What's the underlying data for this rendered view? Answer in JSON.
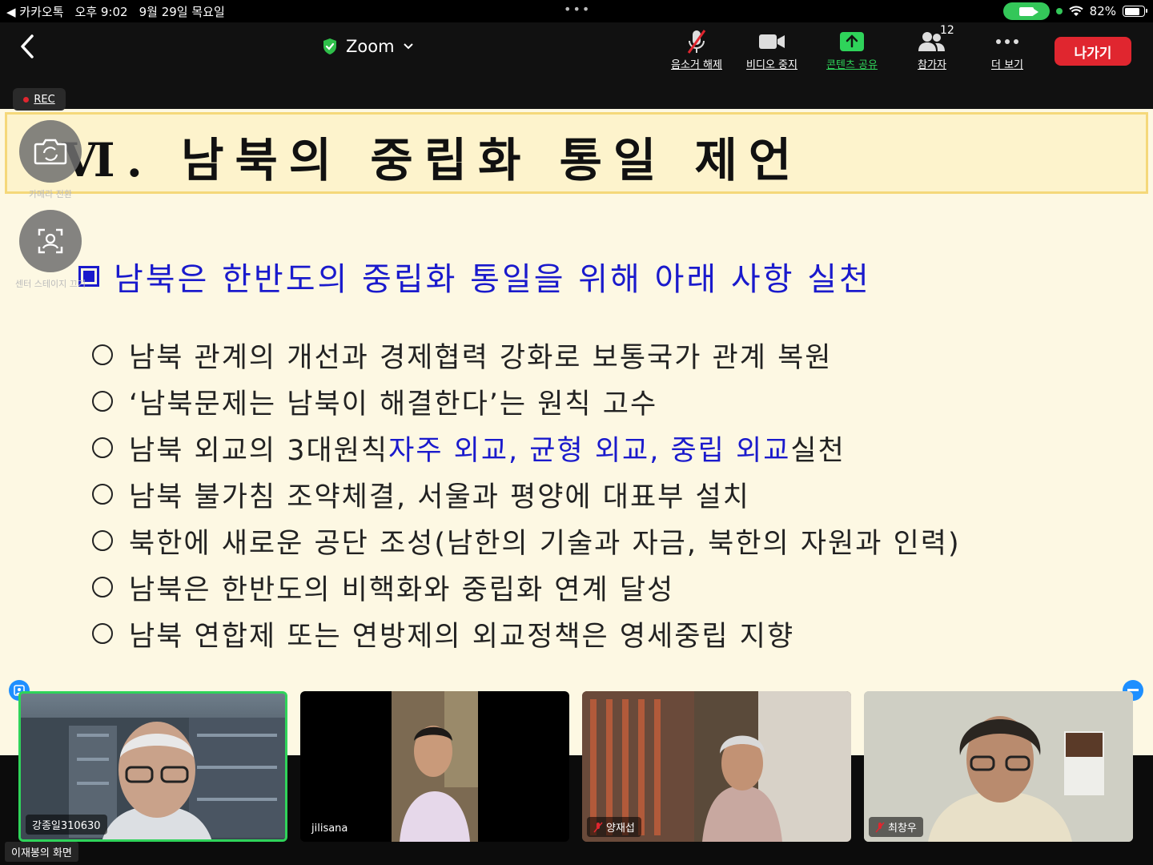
{
  "status_bar": {
    "back_app": "◀ 카카오톡",
    "time": "오후 9:02",
    "date": "9월 29일 목요일",
    "dots": "•••",
    "battery": "82%",
    "battery_level": 0.82
  },
  "toolbar": {
    "title": "Zoom",
    "mute_label": "음소거 해제",
    "video_label": "비디오 중지",
    "share_label": "콘텐츠 공유",
    "participants_label": "참가자",
    "participants_count": "12",
    "more_label": "더 보기",
    "leave_label": "나가기"
  },
  "recording": {
    "label": "REC"
  },
  "overlay": {
    "switch_camera_label": "카메라 전환",
    "center_stage_label": "센터 스테이지 끄기"
  },
  "slide": {
    "title": "Ⅵ. 남북의 중립화 통일 제언",
    "heading": "남북은 한반도의 중립화 통일을 위해 아래 사항 실천",
    "items": [
      "남북 관계의 개선과 경제협력 강화로 보통국가 관계 복원",
      "‘남북문제는 남북이 해결한다’는 원칙 고수",
      {
        "prefix": "남북 외교의 3대원칙 ",
        "highlight": "자주 외교, 균형 외교, 중립 외교",
        "suffix": " 실천"
      },
      "남북 불가침 조약체결, 서울과 평양에 대표부 설치",
      "북한에 새로운 공단 조성(남한의 기술과 자금, 북한의 자원과 인력)",
      "남북은 한반도의 비핵화와 중립화 연계 달성",
      "남북 연합제 또는 연방제의 외교정책은 영세중립 지향"
    ],
    "colors": {
      "heading": "#1a1acc",
      "background": "#fdf8e3",
      "title_bar": "#fdf3cc"
    }
  },
  "gallery": {
    "viewer_label": "이재봉의 화면",
    "tiles": [
      {
        "name": "강종일310630",
        "muted": false,
        "active": true
      },
      {
        "name": "jilisana",
        "muted": false,
        "active": false
      },
      {
        "name": "양재섭",
        "muted": true,
        "active": false
      },
      {
        "name": "최창우",
        "muted": true,
        "active": false
      }
    ]
  }
}
